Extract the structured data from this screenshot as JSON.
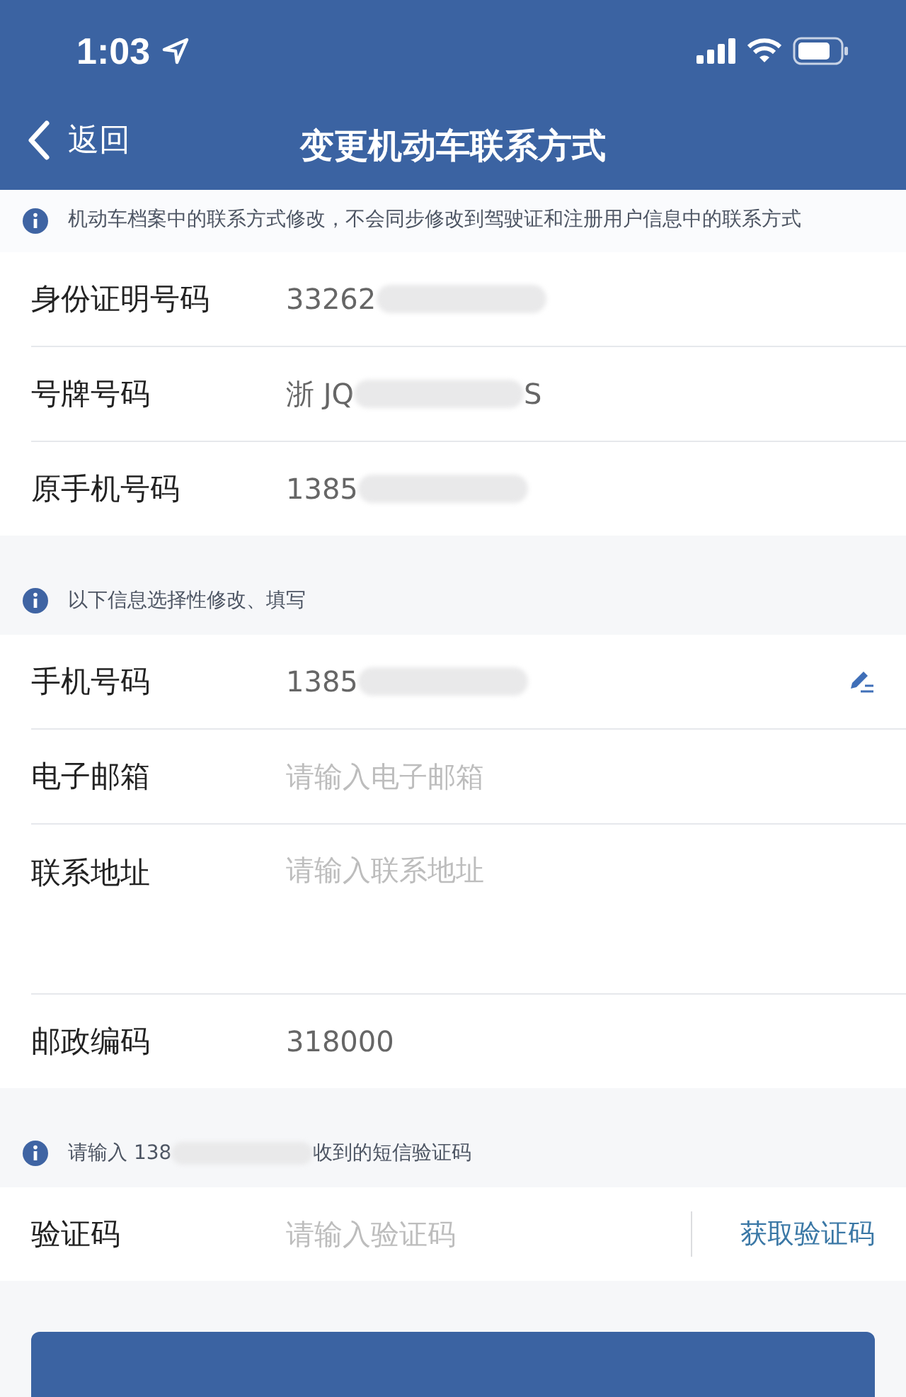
{
  "status_bar": {
    "time": "1:03"
  },
  "nav": {
    "back_label": "返回",
    "title": "变更机动车联系方式"
  },
  "sections": [
    {
      "notice": "机动车档案中的联系方式修改，不会同步修改到驾驶证和注册用户信息中的联系方式",
      "rows": [
        {
          "kind": "value",
          "label": "身份证明号码",
          "value": [
            {
              "kind": "text",
              "text": "33262"
            },
            {
              "kind": "redacted"
            }
          ]
        },
        {
          "kind": "value",
          "label": "号牌号码",
          "value": [
            {
              "kind": "text",
              "text": "浙 JQ"
            },
            {
              "kind": "redacted"
            },
            {
              "kind": "text",
              "text": "S"
            }
          ]
        },
        {
          "kind": "value",
          "label": "原手机号码",
          "value": [
            {
              "kind": "text",
              "text": "1385"
            },
            {
              "kind": "redacted"
            }
          ]
        }
      ]
    },
    {
      "notice": "以下信息选择性修改、填写",
      "rows": [
        {
          "kind": "editable",
          "label": "手机号码",
          "value": [
            {
              "kind": "text",
              "text": "1385"
            },
            {
              "kind": "redacted"
            }
          ]
        },
        {
          "kind": "input",
          "label": "电子邮箱",
          "placeholder": "请输入电子邮箱"
        },
        {
          "kind": "textarea",
          "label": "联系地址",
          "placeholder": "请输入联系地址"
        },
        {
          "kind": "input",
          "label": "邮政编码",
          "value": [
            {
              "kind": "text",
              "text": "318000"
            }
          ]
        }
      ]
    },
    {
      "notice_parts": [
        {
          "kind": "text",
          "text": "请输入 138"
        },
        {
          "kind": "redacted"
        },
        {
          "kind": "text",
          "text": "收到的短信验证码"
        }
      ],
      "rows": [
        {
          "kind": "code",
          "label": "验证码",
          "placeholder": "请输入验证码",
          "action": "获取验证码"
        }
      ]
    }
  ],
  "bottom_button": {
    "visible": true
  }
}
